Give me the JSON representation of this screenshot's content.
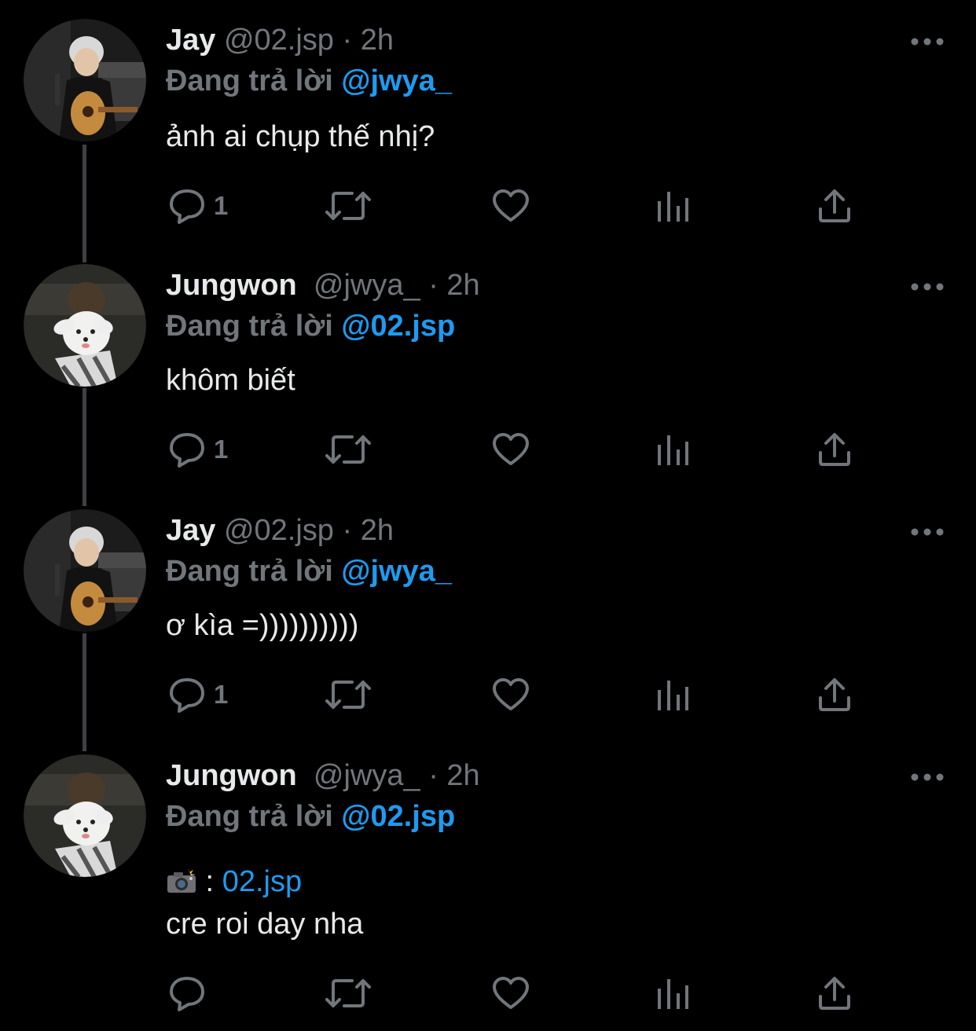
{
  "tweets": [
    {
      "name": "Jay",
      "handle": "@02.jsp",
      "separator": "·",
      "time": "2h",
      "reply_prefix": "Đang trả lời",
      "reply_to": "@jwya_",
      "text": "ảnh ai chụp thế nhị?",
      "reply_count": "1",
      "avatar": "jay-guitar-photo"
    },
    {
      "name": "Jungwon",
      "handle": "@jwya_",
      "separator": "·",
      "time": "2h",
      "reply_prefix": "Đang trả lời",
      "reply_to": "@02.jsp",
      "text": "khôm biết",
      "reply_count": "1",
      "avatar": "jungwon-dog-photo"
    },
    {
      "name": "Jay",
      "handle": "@02.jsp",
      "separator": "·",
      "time": "2h",
      "reply_prefix": "Đang trả lời",
      "reply_to": "@jwya_",
      "text": "ơ kìa =))))))))))",
      "reply_count": "1",
      "avatar": "jay-guitar-photo"
    },
    {
      "name": "Jungwon",
      "handle": "@jwya_",
      "separator": "·",
      "time": "2h",
      "reply_prefix": "Đang trả lời",
      "reply_to": "@02.jsp",
      "credit_separator": " : ",
      "credit_link": "02.jsp",
      "text": "cre roi day nha",
      "reply_count": "",
      "avatar": "jungwon-dog-photo"
    }
  ],
  "icons": {
    "reply": "speech-bubble-icon",
    "retweet": "retweet-icon",
    "like": "heart-icon",
    "analytics": "bar-chart-icon",
    "share": "share-upload-icon",
    "more": "more-dots-icon",
    "camera": "camera-flash-emoji"
  },
  "colors": {
    "background": "#000000",
    "primary_text": "#e7e9ea",
    "secondary_text": "#71767b",
    "accent": "#1d9bf0",
    "thread_line": "#3e4144"
  }
}
